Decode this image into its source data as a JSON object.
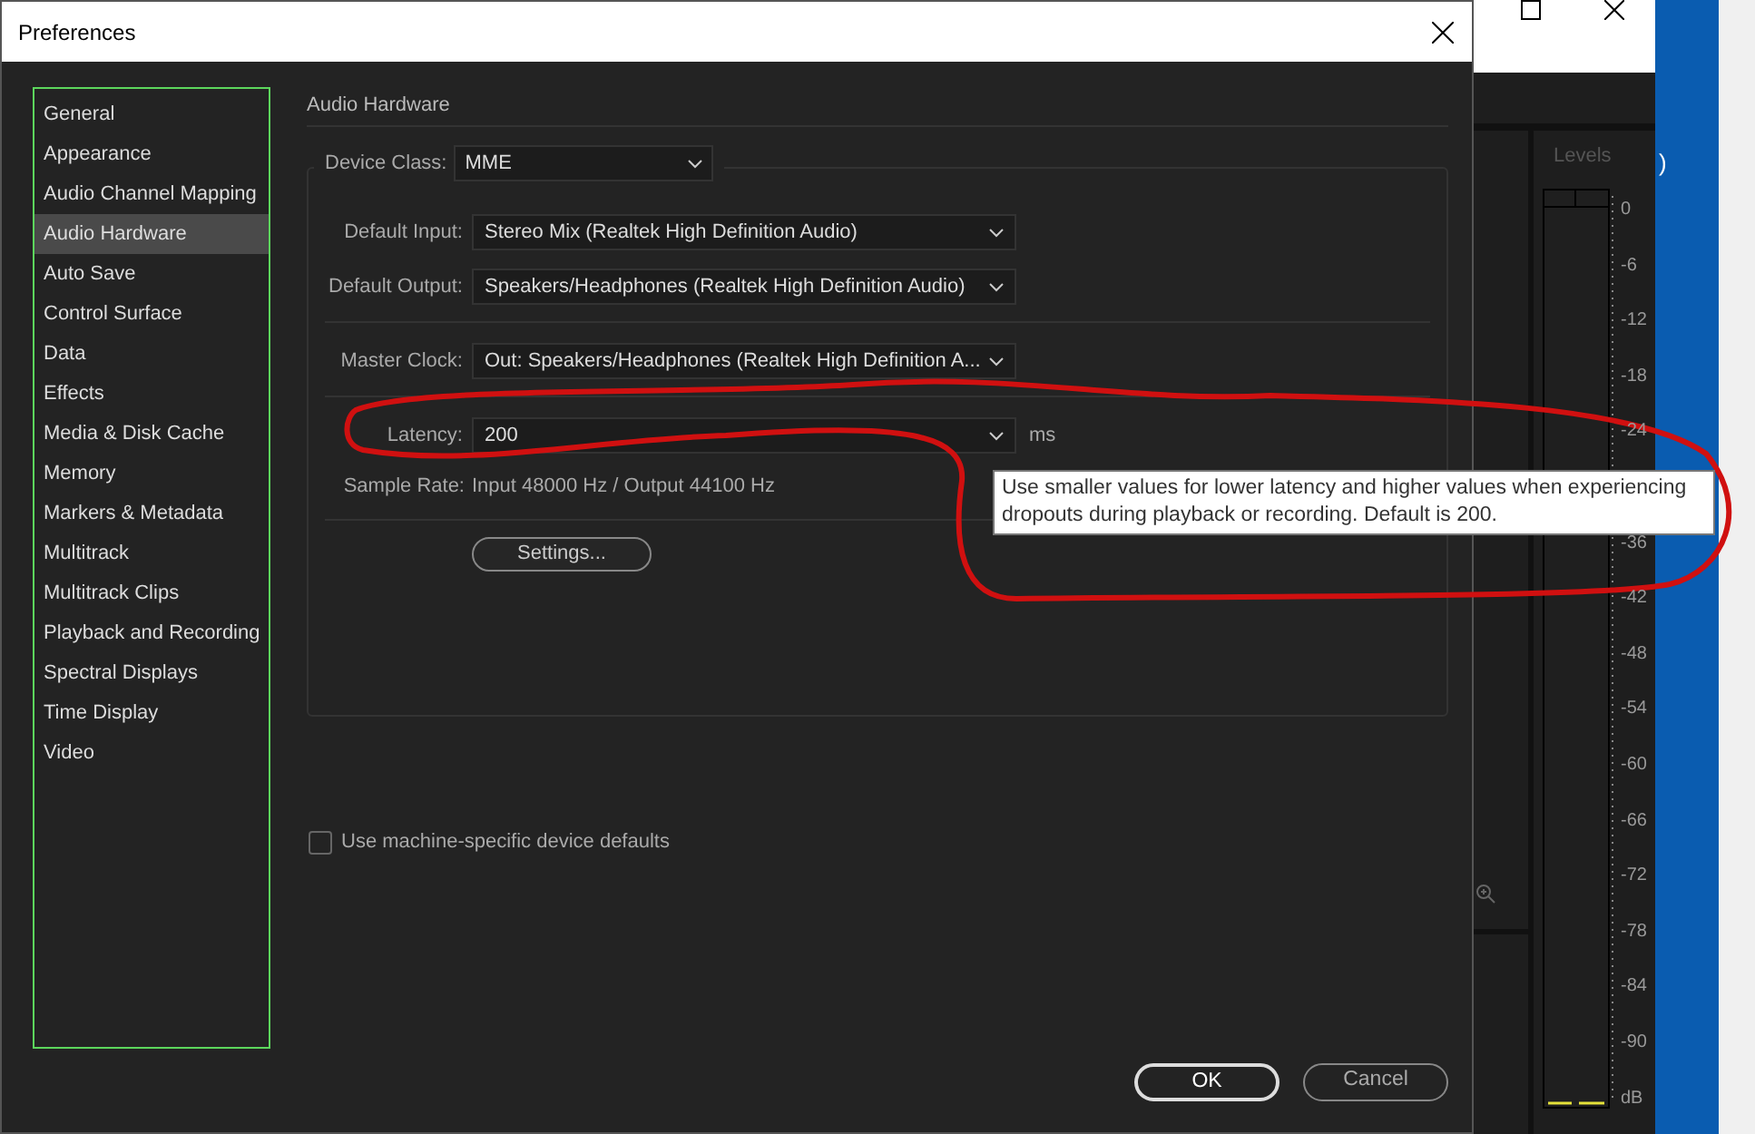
{
  "window": {
    "title": "Preferences"
  },
  "sidebar": {
    "items": [
      {
        "label": "General",
        "selected": false
      },
      {
        "label": "Appearance",
        "selected": false
      },
      {
        "label": "Audio Channel Mapping",
        "selected": false
      },
      {
        "label": "Audio Hardware",
        "selected": true
      },
      {
        "label": "Auto Save",
        "selected": false
      },
      {
        "label": "Control Surface",
        "selected": false
      },
      {
        "label": "Data",
        "selected": false
      },
      {
        "label": "Effects",
        "selected": false
      },
      {
        "label": "Media & Disk Cache",
        "selected": false
      },
      {
        "label": "Memory",
        "selected": false
      },
      {
        "label": "Markers & Metadata",
        "selected": false
      },
      {
        "label": "Multitrack",
        "selected": false
      },
      {
        "label": "Multitrack Clips",
        "selected": false
      },
      {
        "label": "Playback and Recording",
        "selected": false
      },
      {
        "label": "Spectral Displays",
        "selected": false
      },
      {
        "label": "Time Display",
        "selected": false
      },
      {
        "label": "Video",
        "selected": false
      }
    ]
  },
  "section_title": "Audio Hardware",
  "device_class": {
    "label": "Device Class:",
    "value": "MME"
  },
  "device_fields": [
    {
      "label": "Default Input:",
      "value": "Stereo Mix (Realtek High Definition Audio)"
    },
    {
      "label": "Default Output:",
      "value": "Speakers/Headphones (Realtek High Definition Audio)"
    }
  ],
  "master_clock": {
    "label": "Master Clock:",
    "value": "Out: Speakers/Headphones (Realtek High Definition A..."
  },
  "latency": {
    "label": "Latency:",
    "value": "200",
    "unit": "ms"
  },
  "sample_rate": {
    "label": "Sample Rate:",
    "value": "Input 48000 Hz / Output 44100 Hz"
  },
  "settings_button": "Settings...",
  "tooltip": "Use smaller values for lower latency and higher values when experiencing dropouts during playback or recording. Default is 200.",
  "machine_defaults": {
    "label": "Use machine-specific device defaults",
    "checked": false
  },
  "buttons": [
    {
      "label": "OK",
      "kind": "primary"
    },
    {
      "label": "Cancel",
      "kind": "secondary"
    }
  ],
  "background_app": {
    "levels_title": "Levels",
    "edge_text": ")",
    "scale_upper": [
      "0",
      "-6",
      "-12",
      "-18",
      "-24"
    ],
    "scale_lower": [
      "-36",
      "-42",
      "-48",
      "-54",
      "-60",
      "-66",
      "-72",
      "-78",
      "-84",
      "-90",
      "dB"
    ]
  }
}
